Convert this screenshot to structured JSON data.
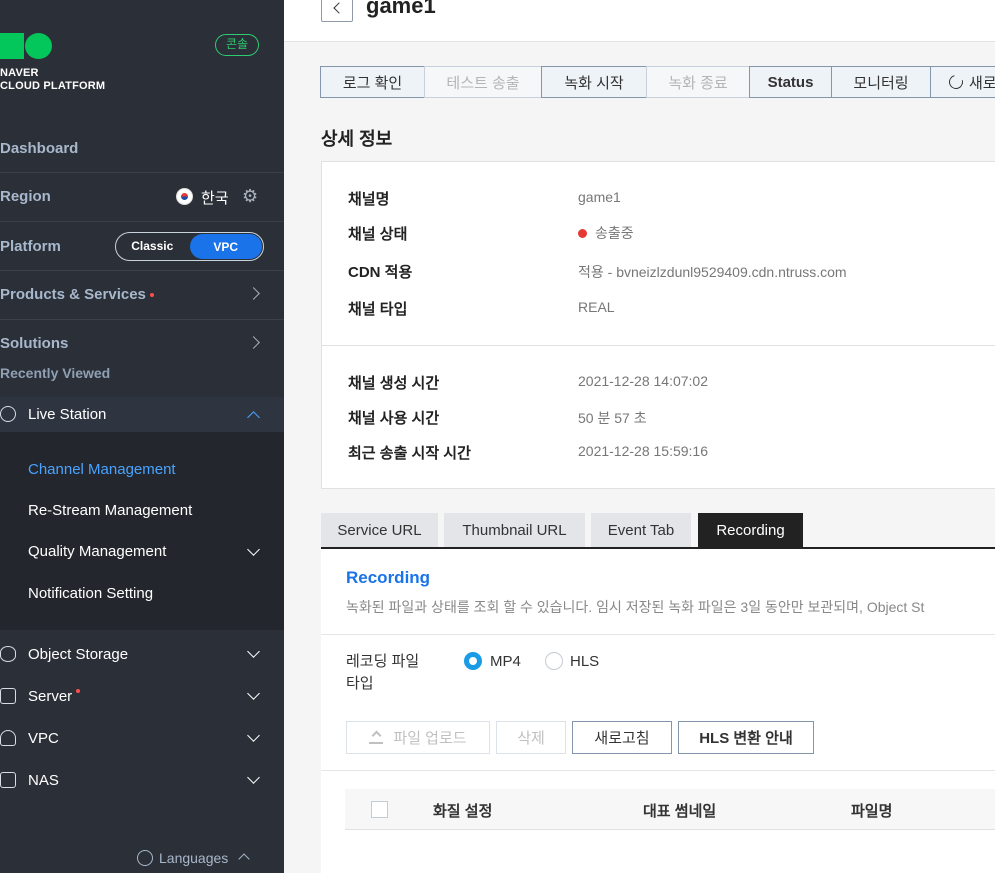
{
  "sidebar": {
    "logo_text": "NAVER\nCLOUD PLATFORM",
    "console_badge": "콘솔",
    "dashboard": "Dashboard",
    "region_label": "Region",
    "region_value": "한국",
    "platform_label": "Platform",
    "platform_options": [
      "Classic",
      "VPC"
    ],
    "platform_selected": "VPC",
    "products_services": "Products & Services",
    "solutions": "Solutions",
    "recently_viewed": "Recently Viewed",
    "live_station": "Live Station",
    "submenu": [
      "Channel Management",
      "Re-Stream Management",
      "Quality Management",
      "Notification Setting"
    ],
    "services": [
      "Object Storage",
      "Server",
      "VPC",
      "NAS"
    ],
    "languages": "Languages"
  },
  "header": {
    "title": "game1"
  },
  "toolbar": {
    "buttons": [
      "로그 확인",
      "테스트 송출",
      "녹화 시작",
      "녹화 종료",
      "Status",
      "모니터링",
      "새로"
    ]
  },
  "detail": {
    "section_title": "상세 정보",
    "rows": [
      {
        "label": "채널명",
        "value": "game1"
      },
      {
        "label": "채널 상태",
        "value": "송출중"
      },
      {
        "label": "CDN 적용",
        "value": "적용 - bvneizlzdunl9529409.cdn.ntruss.com"
      },
      {
        "label": "채널 타입",
        "value": "REAL"
      },
      {
        "label": "채널 생성 시간",
        "value": "2021-12-28 14:07:02"
      },
      {
        "label": "채널 사용 시간",
        "value": "50 분 57 초"
      },
      {
        "label": "최근 송출 시작 시간",
        "value": "2021-12-28 15:59:16"
      }
    ],
    "status_color": "#e53935"
  },
  "tabs": [
    "Service URL",
    "Thumbnail URL",
    "Event Tab",
    "Recording"
  ],
  "active_tab": "Recording",
  "recording": {
    "title": "Recording",
    "description": "녹화된 파일과 상태를 조회 할 수 있습니다. 임시 저장된 녹화 파일은 3일 동안만 보관되며, Object St",
    "file_type_label": "레코딩 파일\n타입",
    "file_types": [
      "MP4",
      "HLS"
    ],
    "file_type_selected": "MP4",
    "buttons": [
      "파일 업로드",
      "삭제",
      "새로고침",
      "HLS 변환 안내"
    ],
    "table_headers": [
      "화질 설정",
      "대표 썸네일",
      "파일명"
    ]
  }
}
